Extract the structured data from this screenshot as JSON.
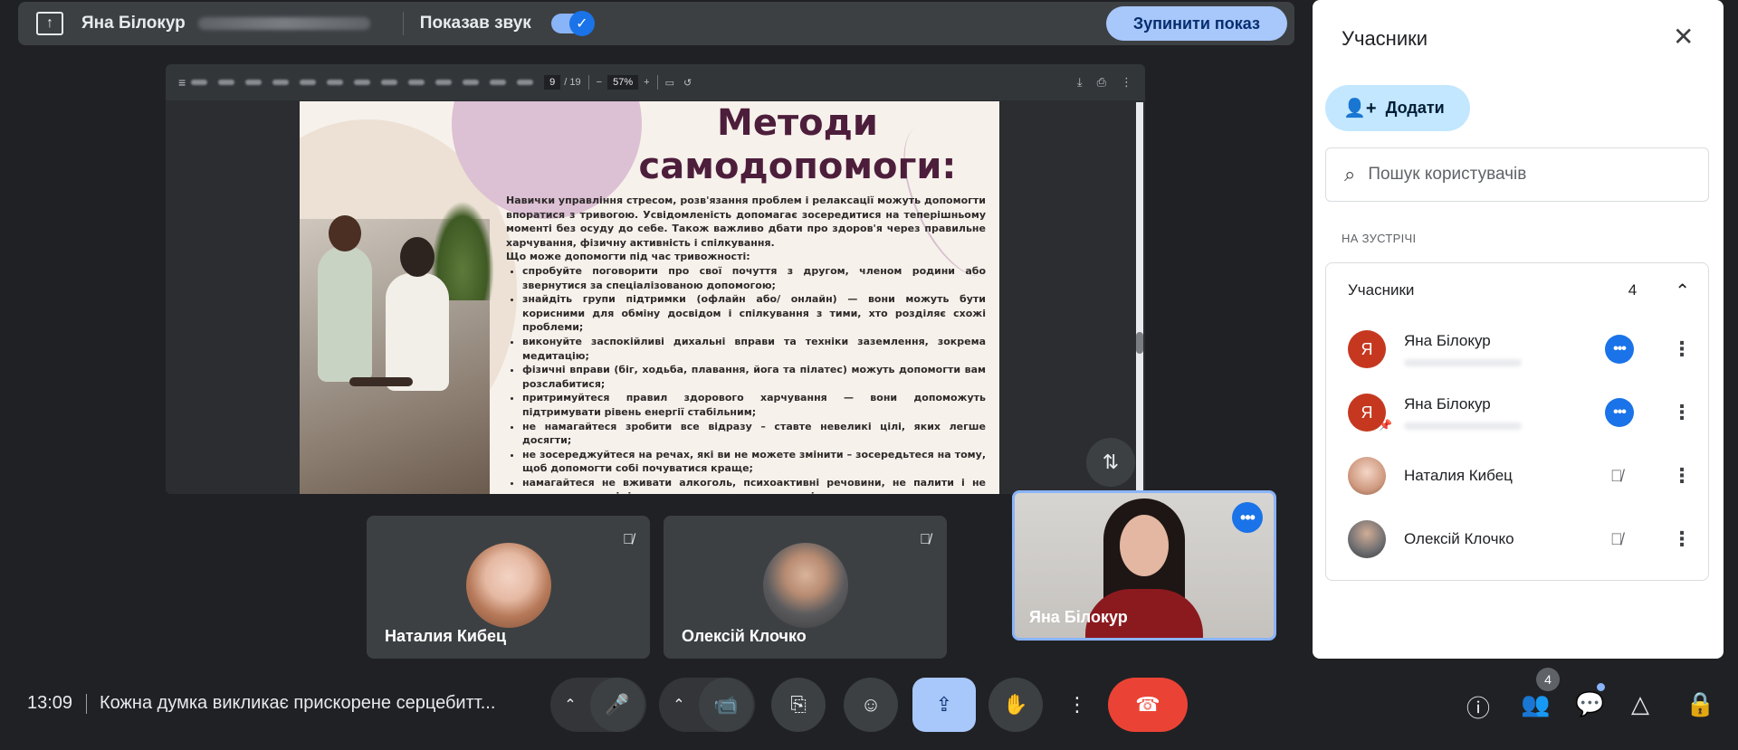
{
  "present_bar": {
    "presenter_name": "Яна Білокур",
    "sound_label": "Показав звук",
    "stop_label": "Зупинити показ"
  },
  "pdf": {
    "page_current": "9",
    "page_total": "/ 19",
    "zoom": "57%",
    "slide_title_line1": "Методи",
    "slide_title_line2": "самодопомоги:",
    "paragraph": "Навички управління стресом, розв'язання проблем і релаксації можуть допомогти впоратися з тривогою. Усвідомленість допомагає зосередитися на теперішньому моменті без осуду до себе. Також важливо дбати про здоров'я через правильне харчування, фізичну активність і спілкування.",
    "subheading": "Що може допомогти під час тривожності:",
    "bullets": [
      "спробуйте поговорити про свої почуття з другом, членом родини або звернутися за спеціалізованою допомогою;",
      "знайдіть групи підтримки (офлайн або/ онлайн) — вони можуть бути корисними для обміну досвідом і спілкування з тими, хто розділяє схожі проблеми;",
      "виконуйте заспокійливі дихальні вправи та техніки заземлення, зокрема медитацію;",
      "фізичні вправи (біг, ходьба, плавання, йога та пілатес) можуть допомогти вам розслабитися;",
      "притримуйтеся правил здорового харчування — вони допоможуть підтримувати рівень енергії стабільним;",
      "не намагайтеся зробити все відразу – ставте невеликі цілі, яких легше досягти;",
      "не зосереджуйтеся на речах, які ви не можете змінити – зосередьтеся на тому, щоб допомогти собі почуватися краще;",
      "намагайтеся не вживати алкоголь, психоактивні речовини, не палити і не грати в азартні ігри для зняття тривоги, оскільки все це може сприяти погіршенню психічного здоров'я."
    ]
  },
  "tiles": {
    "natalia": "Наталия Кибец",
    "oleksii": "Олексій Клочко",
    "self": "Яна Білокур"
  },
  "bottom": {
    "time": "13:09",
    "meeting_title": "Кожна думка викликає прискорене серцебитт...",
    "people_count": "4"
  },
  "panel": {
    "title": "Учасники",
    "add_label": "Додати",
    "search_placeholder": "Пошук користувачів",
    "section_label": "НА ЗУСТРІЧІ",
    "group_label": "Учасники",
    "group_count": "4",
    "participants": [
      {
        "initial": "Я",
        "name": "Яна Білокур"
      },
      {
        "initial": "Я",
        "name": "Яна Білокур"
      },
      {
        "initial": "",
        "name": "Наталия Кибец"
      },
      {
        "initial": "",
        "name": "Олексій Клочко"
      }
    ]
  },
  "colors": {
    "background": "#202124",
    "accent_blue": "#1a73e8",
    "active_button": "#a8c7fa",
    "end_call": "#ea4335",
    "slide_title": "#4d1e3b"
  },
  "icons": {
    "present": "present-to-all-icon",
    "close": "close-icon",
    "add_person": "person-add-icon",
    "search": "search-icon",
    "mic_off": "mic-off-icon",
    "more": "more-dots-icon",
    "swap": "swap-vertical-icon"
  }
}
